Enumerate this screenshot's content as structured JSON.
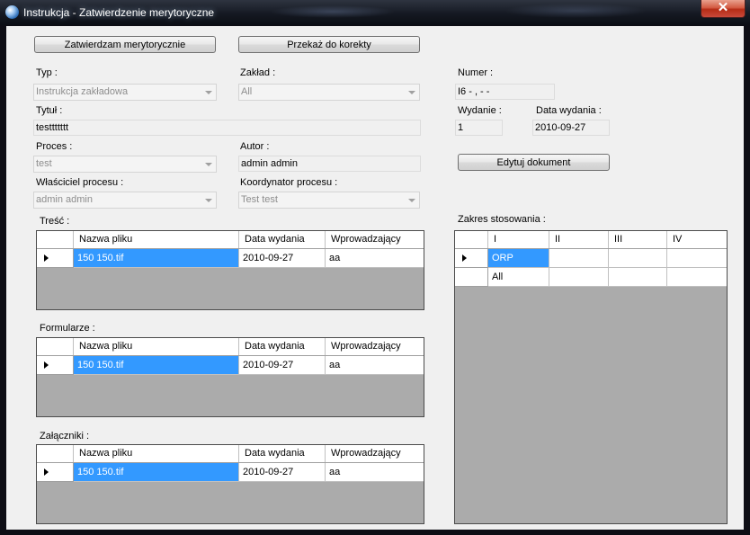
{
  "window": {
    "title": "Instrukcja - Zatwierdzenie merytoryczne",
    "close_label": "✕"
  },
  "buttons": {
    "approve": "Zatwierdzam merytorycznie",
    "to_correction": "Przekaż do korekty",
    "edit_doc": "Edytuj dokument"
  },
  "form": {
    "typ": {
      "label": "Typ :",
      "value": "Instrukcja zakładowa"
    },
    "zaklad": {
      "label": "Zakład :",
      "value": "All"
    },
    "numer": {
      "label": "Numer :",
      "value": "I6 -  ,  -   -"
    },
    "tytul": {
      "label": "Tytuł :",
      "value": "testtttttt"
    },
    "wydanie": {
      "label": "Wydanie :",
      "value": "1"
    },
    "data_wydania": {
      "label": "Data wydania :",
      "value": "2010-09-27"
    },
    "proces": {
      "label": "Proces :",
      "value": "test"
    },
    "autor": {
      "label": "Autor :",
      "value": "admin admin"
    },
    "wlasciciel": {
      "label": "Właściciel procesu :",
      "value": "admin admin"
    },
    "koordynator": {
      "label": "Koordynator procesu :",
      "value": "Test test"
    }
  },
  "tresc": {
    "label": "Treść  :",
    "columns": [
      "Nazwa pliku",
      "Data wydania",
      "Wprowadzający"
    ],
    "rows": [
      [
        "150 150.tif",
        "2010-09-27",
        "aa"
      ]
    ]
  },
  "formularze": {
    "label": "Formularze  :",
    "columns": [
      "Nazwa pliku",
      "Data wydania",
      "Wprowadzający"
    ],
    "rows": [
      [
        "150 150.tif",
        "2010-09-27",
        "aa"
      ]
    ]
  },
  "zalaczniki": {
    "label": "Załączniki  :",
    "columns": [
      "Nazwa pliku",
      "Data wydania",
      "Wprowadzający"
    ],
    "rows": [
      [
        "150 150.tif",
        "2010-09-27",
        "aa"
      ]
    ]
  },
  "zakres": {
    "label": "Zakres stosowania :",
    "columns": [
      "I",
      "II",
      "III",
      "IV"
    ],
    "rows": [
      [
        "ORP",
        "",
        "",
        ""
      ],
      [
        "All",
        "",
        "",
        ""
      ]
    ]
  },
  "colors": {
    "selection": "#3399ff",
    "grid_bg": "#ababab",
    "window_bg": "#f0f0f0"
  },
  "icons": {
    "app": "app-globe-icon",
    "row_indicator": "current-row-arrow-icon"
  }
}
